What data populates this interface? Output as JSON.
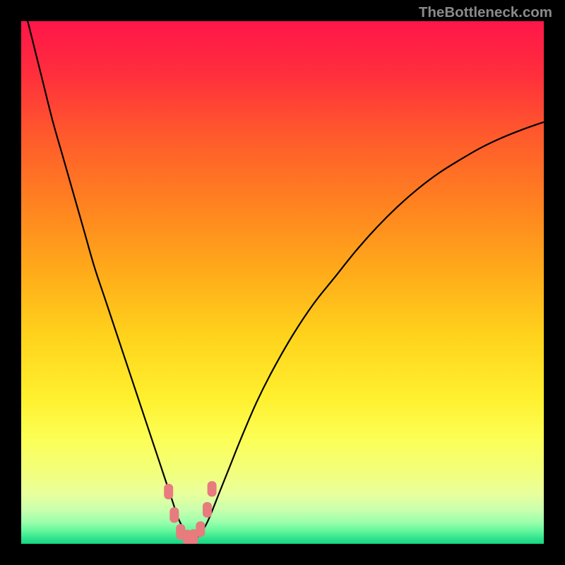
{
  "watermark": "TheBottleneck.com",
  "gradient": {
    "stops": [
      {
        "offset": 0.0,
        "color": "#ff1649"
      },
      {
        "offset": 0.1,
        "color": "#ff2e3d"
      },
      {
        "offset": 0.22,
        "color": "#ff5a2c"
      },
      {
        "offset": 0.35,
        "color": "#ff8220"
      },
      {
        "offset": 0.48,
        "color": "#ffab1a"
      },
      {
        "offset": 0.6,
        "color": "#ffd21c"
      },
      {
        "offset": 0.72,
        "color": "#fff02e"
      },
      {
        "offset": 0.8,
        "color": "#fcff56"
      },
      {
        "offset": 0.86,
        "color": "#f3ff7a"
      },
      {
        "offset": 0.905,
        "color": "#e8ff9c"
      },
      {
        "offset": 0.935,
        "color": "#c9ffad"
      },
      {
        "offset": 0.958,
        "color": "#9cffac"
      },
      {
        "offset": 0.975,
        "color": "#64f79d"
      },
      {
        "offset": 0.99,
        "color": "#2fe28c"
      },
      {
        "offset": 1.0,
        "color": "#17d683"
      }
    ]
  },
  "chart_data": {
    "type": "line",
    "title": "",
    "xlabel": "",
    "ylabel": "",
    "xlim": [
      0,
      100
    ],
    "ylim": [
      0,
      100
    ],
    "series": [
      {
        "name": "bottleneck-curve",
        "x": [
          0,
          2,
          4,
          6,
          8,
          10,
          12,
          14,
          16,
          18,
          20,
          22,
          24,
          26,
          27,
          28,
          29,
          30,
          31,
          32,
          33,
          34,
          35,
          36,
          38,
          40,
          42,
          45,
          48,
          52,
          56,
          60,
          64,
          68,
          72,
          76,
          80,
          84,
          88,
          92,
          96,
          100
        ],
        "y": [
          105,
          97,
          89,
          81,
          74,
          67,
          60,
          53,
          47,
          41,
          35,
          29,
          23,
          17,
          14,
          11,
          8,
          5,
          3,
          1.5,
          1,
          1.5,
          3,
          5,
          10,
          15,
          20,
          27,
          33,
          40,
          46,
          51,
          56,
          60.5,
          64.5,
          68,
          71,
          73.5,
          75.8,
          77.7,
          79.3,
          80.7
        ]
      }
    ],
    "markers": [
      {
        "x": 28.2,
        "y": 10.0,
        "color": "#e77b7e"
      },
      {
        "x": 29.3,
        "y": 5.5,
        "color": "#e77b7e"
      },
      {
        "x": 30.5,
        "y": 2.3,
        "color": "#e77b7e"
      },
      {
        "x": 31.8,
        "y": 1.2,
        "color": "#e77b7e"
      },
      {
        "x": 33.0,
        "y": 1.3,
        "color": "#e77b7e"
      },
      {
        "x": 34.3,
        "y": 2.8,
        "color": "#e77b7e"
      },
      {
        "x": 35.6,
        "y": 6.5,
        "color": "#e77b7e"
      },
      {
        "x": 36.5,
        "y": 10.5,
        "color": "#e77b7e"
      }
    ]
  }
}
